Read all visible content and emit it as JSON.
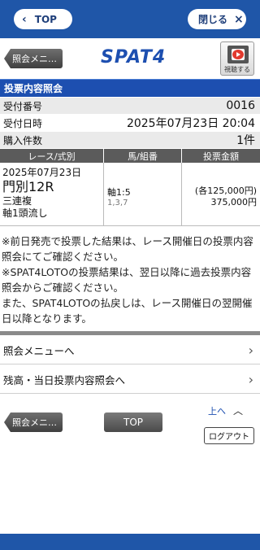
{
  "browser": {
    "top_label": "TOP",
    "top_chevron": "‹",
    "close_label": "閉じる",
    "close_icon": "×"
  },
  "header": {
    "back_label": "照会メニ…",
    "logo": "SPAT4",
    "watch_label": "視聴する"
  },
  "section_title": "投票内容照会",
  "info": [
    {
      "label": "受付番号",
      "value": "0016"
    },
    {
      "label": "受付日時",
      "value": "2025年07月23日 20:04"
    },
    {
      "label": "購入件数",
      "value": "1件"
    }
  ],
  "table": {
    "headers": [
      "レース/式別",
      "馬/組番",
      "投票金額"
    ],
    "date": "2025年07月23日",
    "race": "門別12R",
    "bet_type": "三連複",
    "method": "軸1頭流し",
    "axis": "軸1:5",
    "combo": "1,3,7",
    "amount_each": "(各125,000円)",
    "amount_total": "375,000円"
  },
  "notes": [
    "※前日発売で投票した結果は、レース開催日の投票内容照会にてご確認ください。",
    "※SPAT4LOTOの投票結果は、翌日以降に過去投票内容照会からご確認ください。",
    "また、SPAT4LOTOの払戻しは、レース開催日の翌開催日以降となります。"
  ],
  "menu": [
    {
      "label": "照会メニューへ",
      "arrow": "›"
    },
    {
      "label": "残高・当日投票内容照会へ",
      "arrow": "›"
    }
  ],
  "footer": {
    "back_label": "照会メニ…",
    "top_label": "TOP",
    "up_label": "上へ",
    "up_icon": "︿",
    "logout_label": "ログアウト"
  }
}
